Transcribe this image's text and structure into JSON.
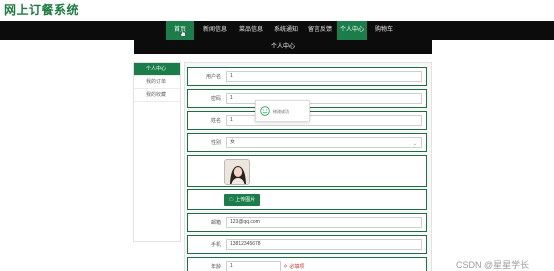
{
  "site": {
    "title": "网上订餐系统"
  },
  "nav": {
    "items": [
      {
        "label": "首页",
        "active": true
      },
      {
        "label": "新闻信息",
        "active": false
      },
      {
        "label": "菜品信息",
        "active": false
      },
      {
        "label": "系统通知",
        "active": false
      },
      {
        "label": "留言反馈",
        "active": false
      },
      {
        "label": "个人中心",
        "active": true
      },
      {
        "label": "购物车",
        "active": false
      }
    ]
  },
  "page": {
    "heading": "个人中心"
  },
  "sidebar": {
    "items": [
      {
        "label": "个人中心",
        "active": true
      },
      {
        "label": "我的订单",
        "active": false
      },
      {
        "label": "我的收藏",
        "active": false
      }
    ]
  },
  "form": {
    "account": {
      "label": "用户名",
      "value": "1"
    },
    "password": {
      "label": "密码",
      "value": "1"
    },
    "name": {
      "label": "姓名",
      "value": "1"
    },
    "gender": {
      "label": "性别",
      "value": "女"
    },
    "upload_label": "上传图片",
    "email": {
      "label": "邮箱",
      "value": "123@qq.com"
    },
    "phone": {
      "label": "手机",
      "value": "13812345678"
    },
    "age": {
      "label": "年龄",
      "value": "1"
    },
    "age_note": "必填项"
  },
  "toast": {
    "text": "修改成功"
  },
  "watermark": "CSDN @星星学长",
  "colors": {
    "brand": "#1a7d4a",
    "title": "#1d7a40",
    "nav_bg": "#0c0c0c"
  }
}
